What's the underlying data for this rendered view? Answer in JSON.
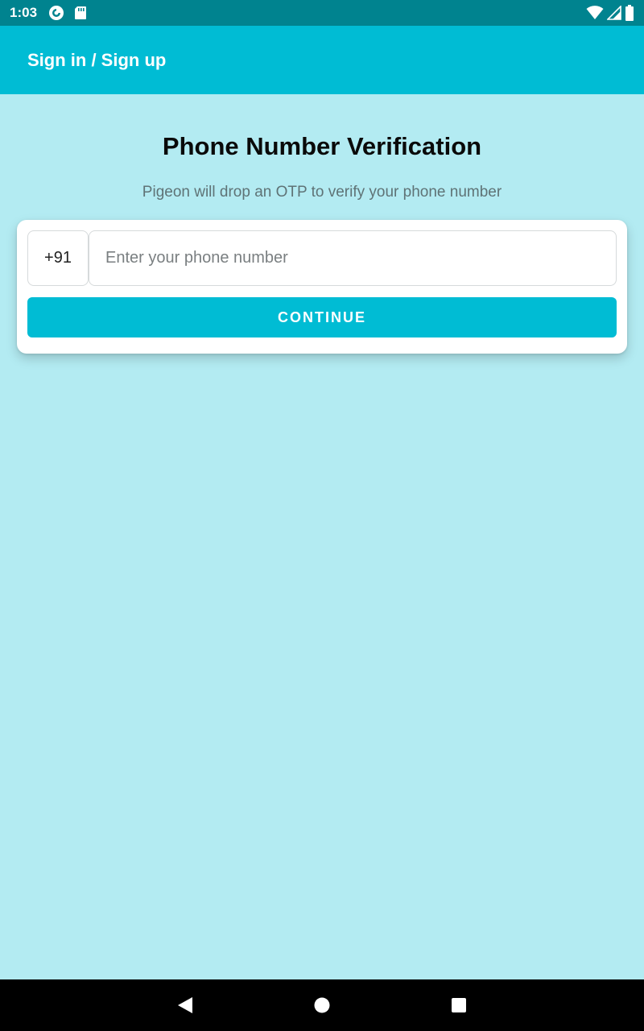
{
  "status_bar": {
    "time": "1:03",
    "left_icons": [
      "pocket-casts-icon",
      "sd-card-icon"
    ],
    "right_icons": [
      "wifi-icon",
      "cell-signal-icon",
      "battery-icon"
    ]
  },
  "app_bar": {
    "title": "Sign in / Sign up"
  },
  "main": {
    "title": "Phone Number Verification",
    "subtitle": "Pigeon will drop an OTP to verify your phone number"
  },
  "form": {
    "country_code": "+91",
    "phone_placeholder": "Enter your phone number",
    "phone_value": "",
    "continue_label": "CONTINUE"
  },
  "nav_bar": {
    "icons": [
      "back-icon",
      "home-icon",
      "recents-icon"
    ]
  },
  "colors": {
    "status_bar": "#00838f",
    "primary": "#00bcd4",
    "background": "#b3ebf2",
    "card": "#ffffff"
  }
}
